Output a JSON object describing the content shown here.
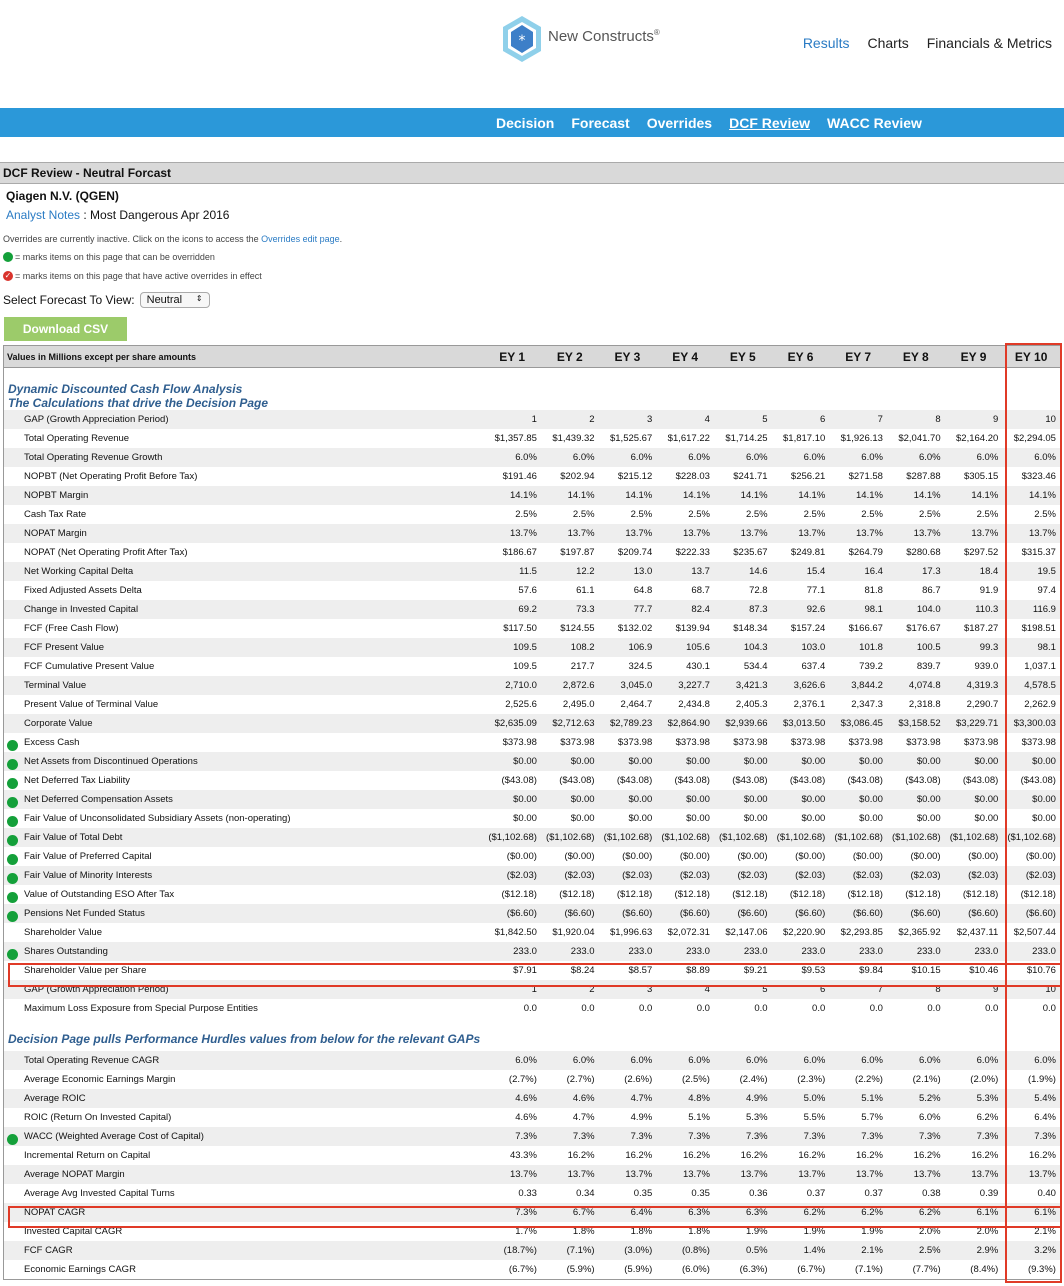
{
  "header": {
    "logo_text": "New Constructs",
    "nav": [
      "Results",
      "Charts",
      "Financials & Metrics"
    ],
    "subnav": [
      "Decision",
      "Forecast",
      "Overrides",
      "DCF Review",
      "WACC Review"
    ]
  },
  "page": {
    "section_title": "DCF Review - Neutral Forcast",
    "company": "Qiagen N.V. (QGEN)",
    "notes_link": "Analyst Notes",
    "notes_text": " : Most Dangerous Apr 2016",
    "overrides_text": "Overrides are currently inactive. Click on the icons to access the ",
    "overrides_link": "Overrides edit page",
    "overrides_end": ".",
    "legend_green": "= marks items on this page that can be overridden",
    "legend_red": "= marks items on this page that have active overrides in effect",
    "select_label": "Select Forecast To View:",
    "select_value": "Neutral",
    "download_label": "Download CSV"
  },
  "table": {
    "header_label": "Values in Millions except per share amounts",
    "columns": [
      "EY 1",
      "EY 2",
      "EY 3",
      "EY 4",
      "EY 5",
      "EY 6",
      "EY 7",
      "EY 8",
      "EY 9",
      "EY 10"
    ],
    "group1_line1": "Dynamic Discounted Cash Flow Analysis",
    "group1_line2": "The Calculations that drive the Decision Page",
    "rows1": [
      {
        "label": "GAP (Growth Appreciation Period)",
        "dot": false,
        "v": [
          "1",
          "2",
          "3",
          "4",
          "5",
          "6",
          "7",
          "8",
          "9",
          "10"
        ]
      },
      {
        "label": "Total Operating Revenue",
        "dot": false,
        "v": [
          "$1,357.85",
          "$1,439.32",
          "$1,525.67",
          "$1,617.22",
          "$1,714.25",
          "$1,817.10",
          "$1,926.13",
          "$2,041.70",
          "$2,164.20",
          "$2,294.05"
        ]
      },
      {
        "label": "Total Operating Revenue Growth",
        "dot": false,
        "v": [
          "6.0%",
          "6.0%",
          "6.0%",
          "6.0%",
          "6.0%",
          "6.0%",
          "6.0%",
          "6.0%",
          "6.0%",
          "6.0%"
        ]
      },
      {
        "label": "NOPBT (Net Operating Profit Before Tax)",
        "dot": false,
        "v": [
          "$191.46",
          "$202.94",
          "$215.12",
          "$228.03",
          "$241.71",
          "$256.21",
          "$271.58",
          "$287.88",
          "$305.15",
          "$323.46"
        ]
      },
      {
        "label": "NOPBT Margin",
        "dot": false,
        "v": [
          "14.1%",
          "14.1%",
          "14.1%",
          "14.1%",
          "14.1%",
          "14.1%",
          "14.1%",
          "14.1%",
          "14.1%",
          "14.1%"
        ]
      },
      {
        "label": "Cash Tax Rate",
        "dot": false,
        "v": [
          "2.5%",
          "2.5%",
          "2.5%",
          "2.5%",
          "2.5%",
          "2.5%",
          "2.5%",
          "2.5%",
          "2.5%",
          "2.5%"
        ]
      },
      {
        "label": "NOPAT Margin",
        "dot": false,
        "v": [
          "13.7%",
          "13.7%",
          "13.7%",
          "13.7%",
          "13.7%",
          "13.7%",
          "13.7%",
          "13.7%",
          "13.7%",
          "13.7%"
        ]
      },
      {
        "label": "NOPAT (Net Operating Profit After Tax)",
        "dot": false,
        "v": [
          "$186.67",
          "$197.87",
          "$209.74",
          "$222.33",
          "$235.67",
          "$249.81",
          "$264.79",
          "$280.68",
          "$297.52",
          "$315.37"
        ]
      },
      {
        "label": "Net Working Capital Delta",
        "dot": false,
        "v": [
          "11.5",
          "12.2",
          "13.0",
          "13.7",
          "14.6",
          "15.4",
          "16.4",
          "17.3",
          "18.4",
          "19.5"
        ]
      },
      {
        "label": "Fixed Adjusted Assets Delta",
        "dot": false,
        "v": [
          "57.6",
          "61.1",
          "64.8",
          "68.7",
          "72.8",
          "77.1",
          "81.8",
          "86.7",
          "91.9",
          "97.4"
        ]
      },
      {
        "label": "Change in Invested Capital",
        "dot": false,
        "v": [
          "69.2",
          "73.3",
          "77.7",
          "82.4",
          "87.3",
          "92.6",
          "98.1",
          "104.0",
          "110.3",
          "116.9"
        ]
      },
      {
        "label": "FCF (Free Cash Flow)",
        "dot": false,
        "v": [
          "$117.50",
          "$124.55",
          "$132.02",
          "$139.94",
          "$148.34",
          "$157.24",
          "$166.67",
          "$176.67",
          "$187.27",
          "$198.51"
        ]
      },
      {
        "label": "FCF Present Value",
        "dot": false,
        "v": [
          "109.5",
          "108.2",
          "106.9",
          "105.6",
          "104.3",
          "103.0",
          "101.8",
          "100.5",
          "99.3",
          "98.1"
        ]
      },
      {
        "label": "FCF Cumulative Present Value",
        "dot": false,
        "v": [
          "109.5",
          "217.7",
          "324.5",
          "430.1",
          "534.4",
          "637.4",
          "739.2",
          "839.7",
          "939.0",
          "1,037.1"
        ]
      },
      {
        "label": "Terminal Value",
        "dot": false,
        "v": [
          "2,710.0",
          "2,872.6",
          "3,045.0",
          "3,227.7",
          "3,421.3",
          "3,626.6",
          "3,844.2",
          "4,074.8",
          "4,319.3",
          "4,578.5"
        ]
      },
      {
        "label": "Present Value of Terminal Value",
        "dot": false,
        "v": [
          "2,525.6",
          "2,495.0",
          "2,464.7",
          "2,434.8",
          "2,405.3",
          "2,376.1",
          "2,347.3",
          "2,318.8",
          "2,290.7",
          "2,262.9"
        ]
      },
      {
        "label": "Corporate Value",
        "dot": false,
        "v": [
          "$2,635.09",
          "$2,712.63",
          "$2,789.23",
          "$2,864.90",
          "$2,939.66",
          "$3,013.50",
          "$3,086.45",
          "$3,158.52",
          "$3,229.71",
          "$3,300.03"
        ]
      },
      {
        "label": "Excess Cash",
        "dot": true,
        "v": [
          "$373.98",
          "$373.98",
          "$373.98",
          "$373.98",
          "$373.98",
          "$373.98",
          "$373.98",
          "$373.98",
          "$373.98",
          "$373.98"
        ]
      },
      {
        "label": "Net Assets from Discontinued Operations",
        "dot": true,
        "v": [
          "$0.00",
          "$0.00",
          "$0.00",
          "$0.00",
          "$0.00",
          "$0.00",
          "$0.00",
          "$0.00",
          "$0.00",
          "$0.00"
        ]
      },
      {
        "label": "Net Deferred Tax Liability",
        "dot": true,
        "v": [
          "($43.08)",
          "($43.08)",
          "($43.08)",
          "($43.08)",
          "($43.08)",
          "($43.08)",
          "($43.08)",
          "($43.08)",
          "($43.08)",
          "($43.08)"
        ]
      },
      {
        "label": "Net Deferred Compensation Assets",
        "dot": true,
        "v": [
          "$0.00",
          "$0.00",
          "$0.00",
          "$0.00",
          "$0.00",
          "$0.00",
          "$0.00",
          "$0.00",
          "$0.00",
          "$0.00"
        ]
      },
      {
        "label": "Fair Value of Unconsolidated Subsidiary Assets (non-operating)",
        "dot": true,
        "v": [
          "$0.00",
          "$0.00",
          "$0.00",
          "$0.00",
          "$0.00",
          "$0.00",
          "$0.00",
          "$0.00",
          "$0.00",
          "$0.00"
        ]
      },
      {
        "label": "Fair Value of Total Debt",
        "dot": true,
        "v": [
          "($1,102.68)",
          "($1,102.68)",
          "($1,102.68)",
          "($1,102.68)",
          "($1,102.68)",
          "($1,102.68)",
          "($1,102.68)",
          "($1,102.68)",
          "($1,102.68)",
          "($1,102.68)"
        ]
      },
      {
        "label": "Fair Value of Preferred Capital",
        "dot": true,
        "v": [
          "($0.00)",
          "($0.00)",
          "($0.00)",
          "($0.00)",
          "($0.00)",
          "($0.00)",
          "($0.00)",
          "($0.00)",
          "($0.00)",
          "($0.00)"
        ]
      },
      {
        "label": "Fair Value of Minority Interests",
        "dot": true,
        "v": [
          "($2.03)",
          "($2.03)",
          "($2.03)",
          "($2.03)",
          "($2.03)",
          "($2.03)",
          "($2.03)",
          "($2.03)",
          "($2.03)",
          "($2.03)"
        ]
      },
      {
        "label": "Value of Outstanding ESO After Tax",
        "dot": true,
        "v": [
          "($12.18)",
          "($12.18)",
          "($12.18)",
          "($12.18)",
          "($12.18)",
          "($12.18)",
          "($12.18)",
          "($12.18)",
          "($12.18)",
          "($12.18)"
        ]
      },
      {
        "label": "Pensions Net Funded Status",
        "dot": true,
        "v": [
          "($6.60)",
          "($6.60)",
          "($6.60)",
          "($6.60)",
          "($6.60)",
          "($6.60)",
          "($6.60)",
          "($6.60)",
          "($6.60)",
          "($6.60)"
        ]
      },
      {
        "label": "Shareholder Value",
        "dot": false,
        "v": [
          "$1,842.50",
          "$1,920.04",
          "$1,996.63",
          "$2,072.31",
          "$2,147.06",
          "$2,220.90",
          "$2,293.85",
          "$2,365.92",
          "$2,437.11",
          "$2,507.44"
        ]
      },
      {
        "label": "Shares Outstanding",
        "dot": true,
        "v": [
          "233.0",
          "233.0",
          "233.0",
          "233.0",
          "233.0",
          "233.0",
          "233.0",
          "233.0",
          "233.0",
          "233.0"
        ]
      },
      {
        "label": "Shareholder Value per Share",
        "dot": false,
        "v": [
          "$7.91",
          "$8.24",
          "$8.57",
          "$8.89",
          "$9.21",
          "$9.53",
          "$9.84",
          "$10.15",
          "$10.46",
          "$10.76"
        ]
      },
      {
        "label": "GAP (Growth Appreciation Period)",
        "dot": false,
        "v": [
          "1",
          "2",
          "3",
          "4",
          "5",
          "6",
          "7",
          "8",
          "9",
          "10"
        ]
      },
      {
        "label": "Maximum Loss Exposure from Special Purpose Entities",
        "dot": false,
        "v": [
          "0.0",
          "0.0",
          "0.0",
          "0.0",
          "0.0",
          "0.0",
          "0.0",
          "0.0",
          "0.0",
          "0.0"
        ]
      }
    ],
    "group2_line1": "Decision Page pulls Performance Hurdles values from below for the relevant GAPs",
    "rows2": [
      {
        "label": "Total Operating Revenue CAGR",
        "dot": false,
        "v": [
          "6.0%",
          "6.0%",
          "6.0%",
          "6.0%",
          "6.0%",
          "6.0%",
          "6.0%",
          "6.0%",
          "6.0%",
          "6.0%"
        ]
      },
      {
        "label": "Average Economic Earnings Margin",
        "dot": false,
        "v": [
          "(2.7%)",
          "(2.7%)",
          "(2.6%)",
          "(2.5%)",
          "(2.4%)",
          "(2.3%)",
          "(2.2%)",
          "(2.1%)",
          "(2.0%)",
          "(1.9%)"
        ]
      },
      {
        "label": "Average ROIC",
        "dot": false,
        "v": [
          "4.6%",
          "4.6%",
          "4.7%",
          "4.8%",
          "4.9%",
          "5.0%",
          "5.1%",
          "5.2%",
          "5.3%",
          "5.4%"
        ]
      },
      {
        "label": "ROIC (Return On Invested Capital)",
        "dot": false,
        "v": [
          "4.6%",
          "4.7%",
          "4.9%",
          "5.1%",
          "5.3%",
          "5.5%",
          "5.7%",
          "6.0%",
          "6.2%",
          "6.4%"
        ]
      },
      {
        "label": "WACC (Weighted Average Cost of Capital)",
        "dot": true,
        "v": [
          "7.3%",
          "7.3%",
          "7.3%",
          "7.3%",
          "7.3%",
          "7.3%",
          "7.3%",
          "7.3%",
          "7.3%",
          "7.3%"
        ]
      },
      {
        "label": "Incremental Return on Capital",
        "dot": false,
        "v": [
          "43.3%",
          "16.2%",
          "16.2%",
          "16.2%",
          "16.2%",
          "16.2%",
          "16.2%",
          "16.2%",
          "16.2%",
          "16.2%"
        ]
      },
      {
        "label": "Average NOPAT Margin",
        "dot": false,
        "v": [
          "13.7%",
          "13.7%",
          "13.7%",
          "13.7%",
          "13.7%",
          "13.7%",
          "13.7%",
          "13.7%",
          "13.7%",
          "13.7%"
        ]
      },
      {
        "label": "Average Avg Invested Capital Turns",
        "dot": false,
        "v": [
          "0.33",
          "0.34",
          "0.35",
          "0.35",
          "0.36",
          "0.37",
          "0.37",
          "0.38",
          "0.39",
          "0.40"
        ]
      },
      {
        "label": "NOPAT CAGR",
        "dot": false,
        "v": [
          "7.3%",
          "6.7%",
          "6.4%",
          "6.3%",
          "6.3%",
          "6.2%",
          "6.2%",
          "6.2%",
          "6.1%",
          "6.1%"
        ]
      },
      {
        "label": "Invested Capital CAGR",
        "dot": false,
        "v": [
          "1.7%",
          "1.8%",
          "1.8%",
          "1.8%",
          "1.9%",
          "1.9%",
          "1.9%",
          "2.0%",
          "2.0%",
          "2.1%"
        ]
      },
      {
        "label": "FCF CAGR",
        "dot": false,
        "v": [
          "(18.7%)",
          "(7.1%)",
          "(3.0%)",
          "(0.8%)",
          "0.5%",
          "1.4%",
          "2.1%",
          "2.5%",
          "2.9%",
          "3.2%"
        ]
      },
      {
        "label": "Economic Earnings CAGR",
        "dot": false,
        "v": [
          "(6.7%)",
          "(5.9%)",
          "(5.9%)",
          "(6.0%)",
          "(6.3%)",
          "(6.7%)",
          "(7.1%)",
          "(7.7%)",
          "(8.4%)",
          "(9.3%)"
        ]
      }
    ]
  }
}
